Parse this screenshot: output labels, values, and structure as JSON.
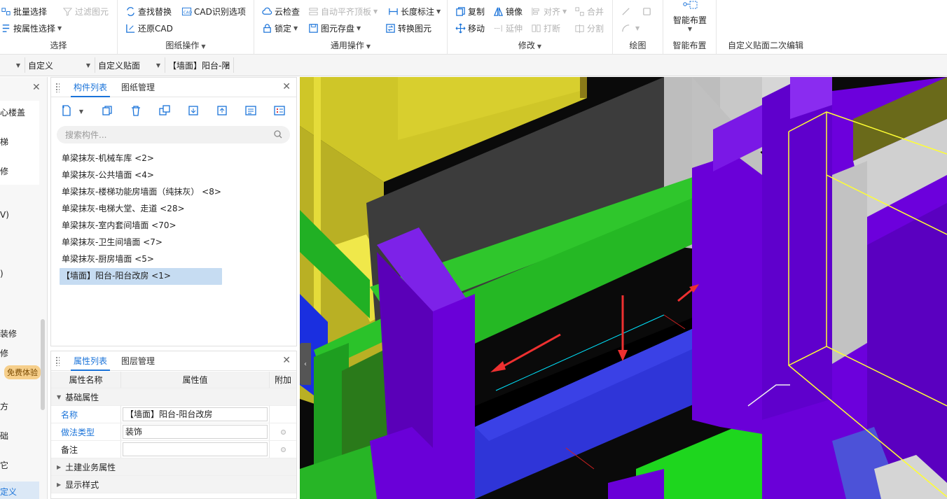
{
  "ribbon": {
    "groups": [
      {
        "title": "选择",
        "items": [
          {
            "label": "批量选择",
            "icon": "batch-select-icon"
          },
          {
            "label": "过滤图元",
            "icon": "filter-icon",
            "disabled": true
          },
          {
            "label": "按属性选择",
            "icon": "select-by-attr-icon",
            "dropdown": true
          }
        ]
      },
      {
        "title": "图纸操作",
        "items": [
          {
            "label": "查找替换",
            "icon": "find-replace-icon"
          },
          {
            "label": "CAD识别选项",
            "icon": "cad-options-icon"
          },
          {
            "label": "还原CAD",
            "icon": "restore-cad-icon"
          }
        ]
      },
      {
        "title": "通用操作",
        "items": [
          {
            "label": "云检查",
            "icon": "cloud-check-icon"
          },
          {
            "label": "自动平齐顶板",
            "icon": "auto-align-icon",
            "disabled": true,
            "dropdown": true
          },
          {
            "label": "长度标注",
            "icon": "length-dim-icon",
            "dropdown": true
          },
          {
            "label": "锁定",
            "icon": "lock-icon",
            "dropdown": true
          },
          {
            "label": "图元存盘",
            "icon": "save-element-icon",
            "dropdown": true
          },
          {
            "label": "转换图元",
            "icon": "convert-icon"
          }
        ]
      },
      {
        "title": "修改",
        "items": [
          {
            "label": "复制",
            "icon": "copy-icon"
          },
          {
            "label": "镜像",
            "icon": "mirror-icon"
          },
          {
            "label": "对齐",
            "icon": "align-icon",
            "disabled": true,
            "dropdown": true
          },
          {
            "label": "合并",
            "icon": "merge-icon",
            "disabled": true
          },
          {
            "label": "移动",
            "icon": "move-icon"
          },
          {
            "label": "延伸",
            "icon": "extend-icon",
            "disabled": true
          },
          {
            "label": "打断",
            "icon": "break-icon",
            "disabled": true
          },
          {
            "label": "分割",
            "icon": "split-icon",
            "disabled": true
          }
        ]
      },
      {
        "title": "绘图"
      },
      {
        "title": "智能布置",
        "items": [
          {
            "label": "智能布置",
            "icon": "smart-layout-icon",
            "dropdown": true
          }
        ]
      },
      {
        "title": "自定义贴面二次编辑"
      }
    ]
  },
  "selbar": {
    "items": [
      "",
      "自定义",
      "自定义贴面",
      "【墙面】阳台-阳"
    ]
  },
  "leftnav": {
    "items": [
      "心楼盖",
      "梯",
      "修",
      "V)",
      ")",
      "装修",
      "修",
      "免费体验",
      "方",
      "础",
      "它",
      "定义"
    ]
  },
  "complist": {
    "tabs": [
      "构件列表",
      "图纸管理"
    ],
    "search_placeholder": "搜索构件...",
    "items": [
      "单梁抹灰-机械车库 <2>",
      "单梁抹灰-公共墙面 <4>",
      "单梁抹灰-楼梯功能房墙面（纯抹灰） <8>",
      "单梁抹灰-电梯大堂、走道 <28>",
      "单梁抹灰-室内套间墙面 <70>",
      "单梁抹灰-卫生间墙面 <7>",
      "单梁抹灰-厨房墙面 <5>",
      "【墙面】阳台-阳台改房 <1>"
    ],
    "selected_index": 7
  },
  "props": {
    "tabs": [
      "属性列表",
      "图层管理"
    ],
    "headers": [
      "属性名称",
      "属性值",
      "附加"
    ],
    "group_basic": "基础属性",
    "rows": [
      {
        "name": "名称",
        "value": "【墙面】阳台-阳台改房",
        "link": true,
        "check": false
      },
      {
        "name": "做法类型",
        "value": "装饰",
        "link": true,
        "check": true
      },
      {
        "name": "备注",
        "value": "",
        "link": false,
        "check": true
      }
    ],
    "group_civil": "土建业务属性",
    "group_display": "显示样式"
  },
  "colors": {
    "accent": "#1a73d9",
    "selected_row": "#c6dcf2",
    "purple": "#6a00d8",
    "green": "#22b022",
    "blue": "#2f35d8",
    "yellow": "#cfc628",
    "dark_gray": "#3c3c3c"
  }
}
